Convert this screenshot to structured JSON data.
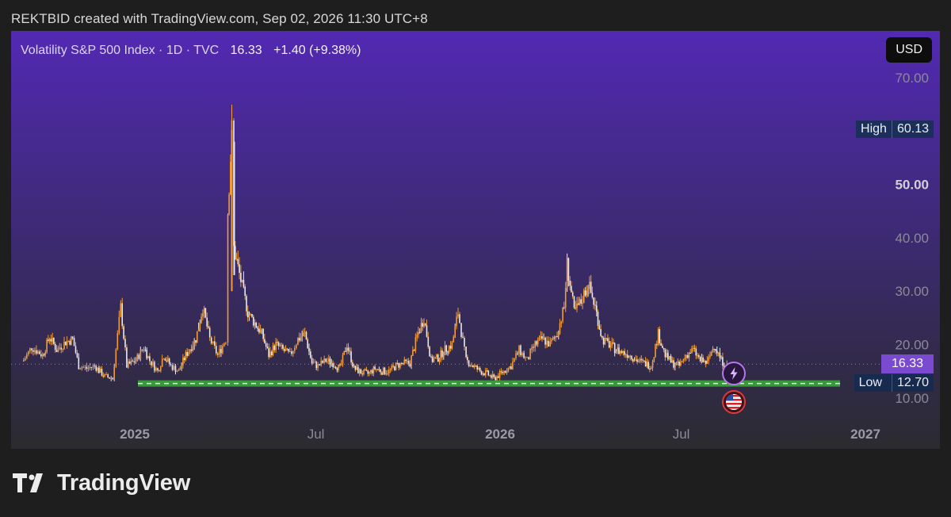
{
  "caption": "REKTBID created with TradingView.com, Sep 02, 2026 11:30 UTC+8",
  "legend": {
    "symbol": "Volatility S&P 500 Index · 1D · TVC",
    "last": "16.33",
    "change": "+1.40 (+9.38%)"
  },
  "currency_button": "USD",
  "high_tag": {
    "label": "High",
    "value": "60.13"
  },
  "low_tag": {
    "label": "Low",
    "value": "12.70"
  },
  "last_tag": "16.33",
  "brand": "TradingView",
  "colors": {
    "bg_top": "#5229b3",
    "bg_bottom": "#2b2b30",
    "candle": "#f29b35",
    "candle_alt": "#e8e8e8",
    "low_line": "#3aa53a",
    "last_tag": "#7a4bd0"
  },
  "icons": [
    "lightning-icon",
    "us-flag-icon"
  ],
  "chart_data": {
    "type": "line",
    "title": "Volatility S&P 500 Index · 1D · TVC",
    "ylim": [
      8,
      75
    ],
    "y_ticks": [
      "70.00",
      "50.00",
      "40.00",
      "30.00",
      "20.00",
      "10.00"
    ],
    "x_ticks": [
      "2025",
      "Jul",
      "2026",
      "Jul",
      "2027"
    ],
    "high": 60.13,
    "low": 12.7,
    "last": 16.33,
    "series": [
      {
        "values": [
          [
            "2024-09-12",
            17.0
          ],
          [
            "2024-09-20",
            19.5
          ],
          [
            "2024-10-01",
            18.0
          ],
          [
            "2024-10-08",
            21.5
          ],
          [
            "2024-10-15",
            19.0
          ],
          [
            "2024-10-24",
            20.5
          ],
          [
            "2024-10-31",
            21.0
          ],
          [
            "2024-11-06",
            16.0
          ],
          [
            "2024-11-14",
            15.5
          ],
          [
            "2024-11-22",
            16.0
          ],
          [
            "2024-12-02",
            14.0
          ],
          [
            "2024-12-10",
            13.7
          ],
          [
            "2024-12-18",
            27.0
          ],
          [
            "2024-12-24",
            16.0
          ],
          [
            "2025-01-02",
            17.0
          ],
          [
            "2025-01-10",
            19.5
          ],
          [
            "2025-01-16",
            17.0
          ],
          [
            "2025-01-24",
            15.0
          ],
          [
            "2025-01-30",
            18.0
          ],
          [
            "2025-02-06",
            16.0
          ],
          [
            "2025-02-14",
            15.0
          ],
          [
            "2025-02-21",
            18.0
          ],
          [
            "2025-03-03",
            21.0
          ],
          [
            "2025-03-10",
            27.0
          ],
          [
            "2025-03-17",
            21.0
          ],
          [
            "2025-03-25",
            18.0
          ],
          [
            "2025-04-02",
            21.0
          ],
          [
            "2025-04-04",
            45.0
          ],
          [
            "2025-04-08",
            60.13
          ],
          [
            "2025-04-10",
            38.0
          ],
          [
            "2025-04-17",
            32.0
          ],
          [
            "2025-04-24",
            26.0
          ],
          [
            "2025-05-01",
            24.0
          ],
          [
            "2025-05-08",
            22.0
          ],
          [
            "2025-05-15",
            18.0
          ],
          [
            "2025-05-22",
            20.0
          ],
          [
            "2025-05-29",
            19.0
          ],
          [
            "2025-06-05",
            18.0
          ],
          [
            "2025-06-13",
            21.0
          ],
          [
            "2025-06-20",
            22.0
          ],
          [
            "2025-06-27",
            16.5
          ],
          [
            "2025-07-03",
            16.0
          ],
          [
            "2025-07-11",
            17.0
          ],
          [
            "2025-07-18",
            16.5
          ],
          [
            "2025-07-25",
            15.5
          ],
          [
            "2025-08-01",
            20.0
          ],
          [
            "2025-08-08",
            15.5
          ],
          [
            "2025-08-15",
            14.8
          ],
          [
            "2025-08-22",
            14.5
          ],
          [
            "2025-08-29",
            15.5
          ],
          [
            "2025-09-05",
            15.0
          ],
          [
            "2025-09-12",
            15.0
          ],
          [
            "2025-09-19",
            16.0
          ],
          [
            "2025-09-26",
            16.5
          ],
          [
            "2025-10-03",
            16.5
          ],
          [
            "2025-10-10",
            21.5
          ],
          [
            "2025-10-17",
            25.0
          ],
          [
            "2025-10-24",
            17.0
          ],
          [
            "2025-10-31",
            17.5
          ],
          [
            "2025-11-07",
            19.0
          ],
          [
            "2025-11-14",
            20.0
          ],
          [
            "2025-11-20",
            26.0
          ],
          [
            "2025-11-28",
            17.0
          ],
          [
            "2025-12-05",
            16.0
          ],
          [
            "2025-12-12",
            15.0
          ],
          [
            "2025-12-19",
            14.5
          ],
          [
            "2025-12-26",
            13.6
          ],
          [
            "2026-01-05",
            15.0
          ],
          [
            "2026-01-12",
            16.0
          ],
          [
            "2026-01-20",
            19.0
          ],
          [
            "2026-01-28",
            17.0
          ],
          [
            "2026-02-05",
            20.0
          ],
          [
            "2026-02-12",
            21.0
          ],
          [
            "2026-02-20",
            20.0
          ],
          [
            "2026-02-27",
            22.0
          ],
          [
            "2026-03-06",
            27.0
          ],
          [
            "2026-03-09",
            35.0
          ],
          [
            "2026-03-16",
            26.0
          ],
          [
            "2026-03-23",
            28.0
          ],
          [
            "2026-03-30",
            31.5
          ],
          [
            "2026-04-06",
            27.0
          ],
          [
            "2026-04-13",
            21.0
          ],
          [
            "2026-04-20",
            20.0
          ],
          [
            "2026-04-27",
            19.0
          ],
          [
            "2026-05-04",
            18.5
          ],
          [
            "2026-05-11",
            18.0
          ],
          [
            "2026-05-18",
            17.0
          ],
          [
            "2026-05-25",
            16.5
          ],
          [
            "2026-06-01",
            16.0
          ],
          [
            "2026-06-08",
            22.0
          ],
          [
            "2026-06-15",
            18.0
          ],
          [
            "2026-06-22",
            16.5
          ],
          [
            "2026-06-29",
            16.0
          ],
          [
            "2026-07-06",
            18.0
          ],
          [
            "2026-07-13",
            19.0
          ],
          [
            "2026-07-20",
            17.0
          ],
          [
            "2026-07-27",
            16.5
          ],
          [
            "2026-08-03",
            20.0
          ],
          [
            "2026-08-10",
            17.0
          ],
          [
            "2026-08-17",
            15.5
          ],
          [
            "2026-08-24",
            14.5
          ],
          [
            "2026-08-31",
            14.93
          ],
          [
            "2026-09-01",
            16.33
          ]
        ]
      }
    ]
  }
}
